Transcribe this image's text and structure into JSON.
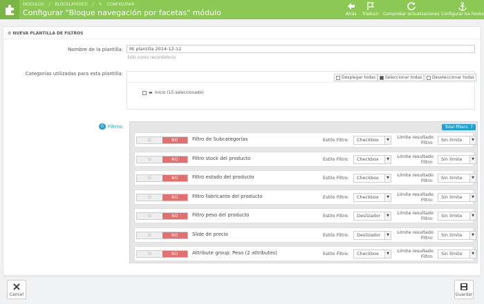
{
  "breadcrumb": [
    "MÓDULOS",
    "BLOCKLAYERED",
    "CONFIGURAR"
  ],
  "page_title": "Configurar \"Bloque navegación por facetas\" módulo",
  "toolbar": [
    {
      "label": "Atrás",
      "icon": "back-arrow-icon"
    },
    {
      "label": "Traducir",
      "icon": "flag-icon"
    },
    {
      "label": "Comprobar actualizaciones",
      "icon": "refresh-icon"
    },
    {
      "label": "Configurar los hooks",
      "icon": "anchor-icon"
    }
  ],
  "panel_heading": "NUEVA PLANTILLA DE FILTROS",
  "template_name_label": "Nombre de la plantilla:",
  "template_name_value": "Mi plantilla 2014-12-12",
  "template_name_hint": "Sólo como recordatorio",
  "categories_label": "Categorías utilizadas para esta plantilla:",
  "tree_buttons": {
    "expand": "Desplegar todas",
    "select": "Seleccionar todas",
    "deselect": "Deseleccionar todas"
  },
  "tree_root": "Inicio (15 seleccionado)",
  "filters_count": "0",
  "filters_label": "Filtros:",
  "total_filters": "Total filters: 7",
  "toggle": {
    "yes": "SÍ",
    "no": "NO"
  },
  "style_label": "Estilo Filtro:",
  "limit_label": "Límite resultado Filtro:",
  "filters": [
    {
      "name": "Filtro de Subcategorías",
      "style": "Checkbox",
      "limit": "Sin límite"
    },
    {
      "name": "Filtro stock del producto",
      "style": "Checkbox",
      "limit": "Sin límite"
    },
    {
      "name": "Filtro estado del producto",
      "style": "Checkbox",
      "limit": "Sin límite"
    },
    {
      "name": "Filtro fabricante del producto",
      "style": "Checkbox",
      "limit": "Sin límite"
    },
    {
      "name": "Filtro peso del producto",
      "style": "Deslizador",
      "limit": "Sin límite"
    },
    {
      "name": "Slide de precio",
      "style": "Deslizador",
      "limit": "Sin límite"
    },
    {
      "name": "Attribute group: Peso (2 attributes)",
      "style": "Checkbox",
      "limit": "Sin límite"
    }
  ],
  "cancel_label": "Cancel",
  "save_label": "Guardar",
  "colors": {
    "header": "#8bc954",
    "accent": "#1ba2d2",
    "toggle_no": "#e36f6f"
  }
}
